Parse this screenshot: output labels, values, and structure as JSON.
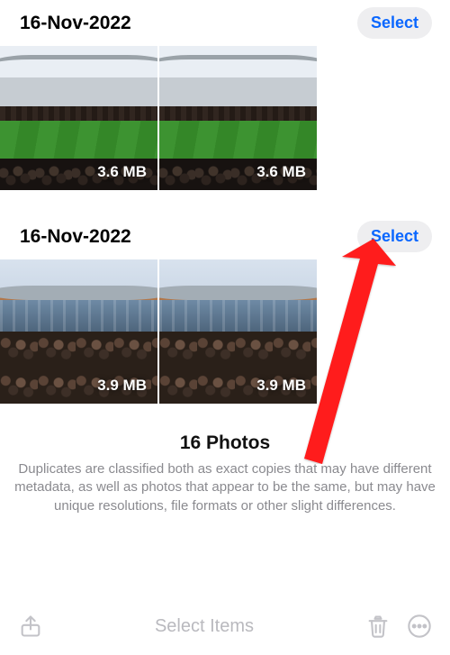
{
  "groups": [
    {
      "date": "16-Nov-2022",
      "select_label": "Select",
      "photos": [
        {
          "size": "3.6 MB"
        },
        {
          "size": "3.6 MB"
        }
      ]
    },
    {
      "date": "16-Nov-2022",
      "select_label": "Select",
      "photos": [
        {
          "size": "3.9 MB"
        },
        {
          "size": "3.9 MB"
        }
      ]
    }
  ],
  "summary": {
    "title": "16 Photos",
    "description": "Duplicates are classified both as exact copies that may have different metadata, as well as photos that appear to be the same, but may have unique resolutions, file formats or other slight differences."
  },
  "toolbar": {
    "select_items_label": "Select Items"
  },
  "icons": {
    "share": "share-icon",
    "trash": "trash-icon",
    "more": "more-icon"
  },
  "accent_color": "#0a67ff"
}
